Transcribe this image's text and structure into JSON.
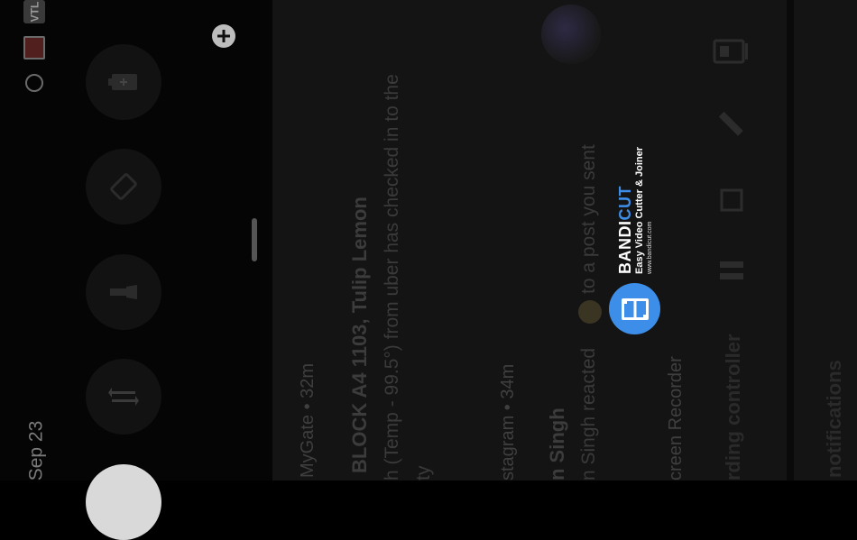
{
  "status_bar": {
    "volume_badge": "VTL",
    "icons": [
      "screen-cast-icon",
      "alarm-icon"
    ],
    "date": "Sep 23"
  },
  "quick_settings": {
    "tiles": [
      {
        "name": "battery-saver",
        "icon": "battery-icon"
      },
      {
        "name": "auto-rotate",
        "icon": "rotate-icon"
      },
      {
        "name": "flashlight",
        "icon": "flashlight-icon"
      },
      {
        "name": "mobile-data",
        "icon": "data-transfer-icon"
      }
    ],
    "add_icon": "plus-icon"
  },
  "notifications": [
    {
      "app": "MyGate",
      "time": "32m",
      "meta_text": "MyGate • 32m",
      "title": "BLOCK A4 1103, Tulip Lemon",
      "body": "h (Temp - 99.5°) from uber has checked in to the",
      "body2": "ty"
    },
    {
      "app": "Instagram",
      "time": "34m",
      "meta_text": "stagram • 34m",
      "title": "n Singh",
      "body_pre": "n Singh reacted",
      "body_post": "to a post you sent"
    },
    {
      "app": "Screen Recorder",
      "meta_text": "creen Recorder",
      "title": "rding controller"
    }
  ],
  "recording_controller": {
    "icons": [
      "record-settings-icon",
      "draw-pencil-icon",
      "stop-icon",
      "pause-icon"
    ]
  },
  "footer": {
    "label": "notifications"
  },
  "watermark": {
    "brand_a": "BANDI",
    "brand_b": "CUT",
    "tagline": "Easy Video Cutter & Joiner",
    "url": "www.bandicut.com",
    "accent": "#3d8ee8"
  },
  "colors": {
    "shade_bg": "#050505",
    "notification_bg": "#141414",
    "text_dim": "#3c3c3c"
  }
}
